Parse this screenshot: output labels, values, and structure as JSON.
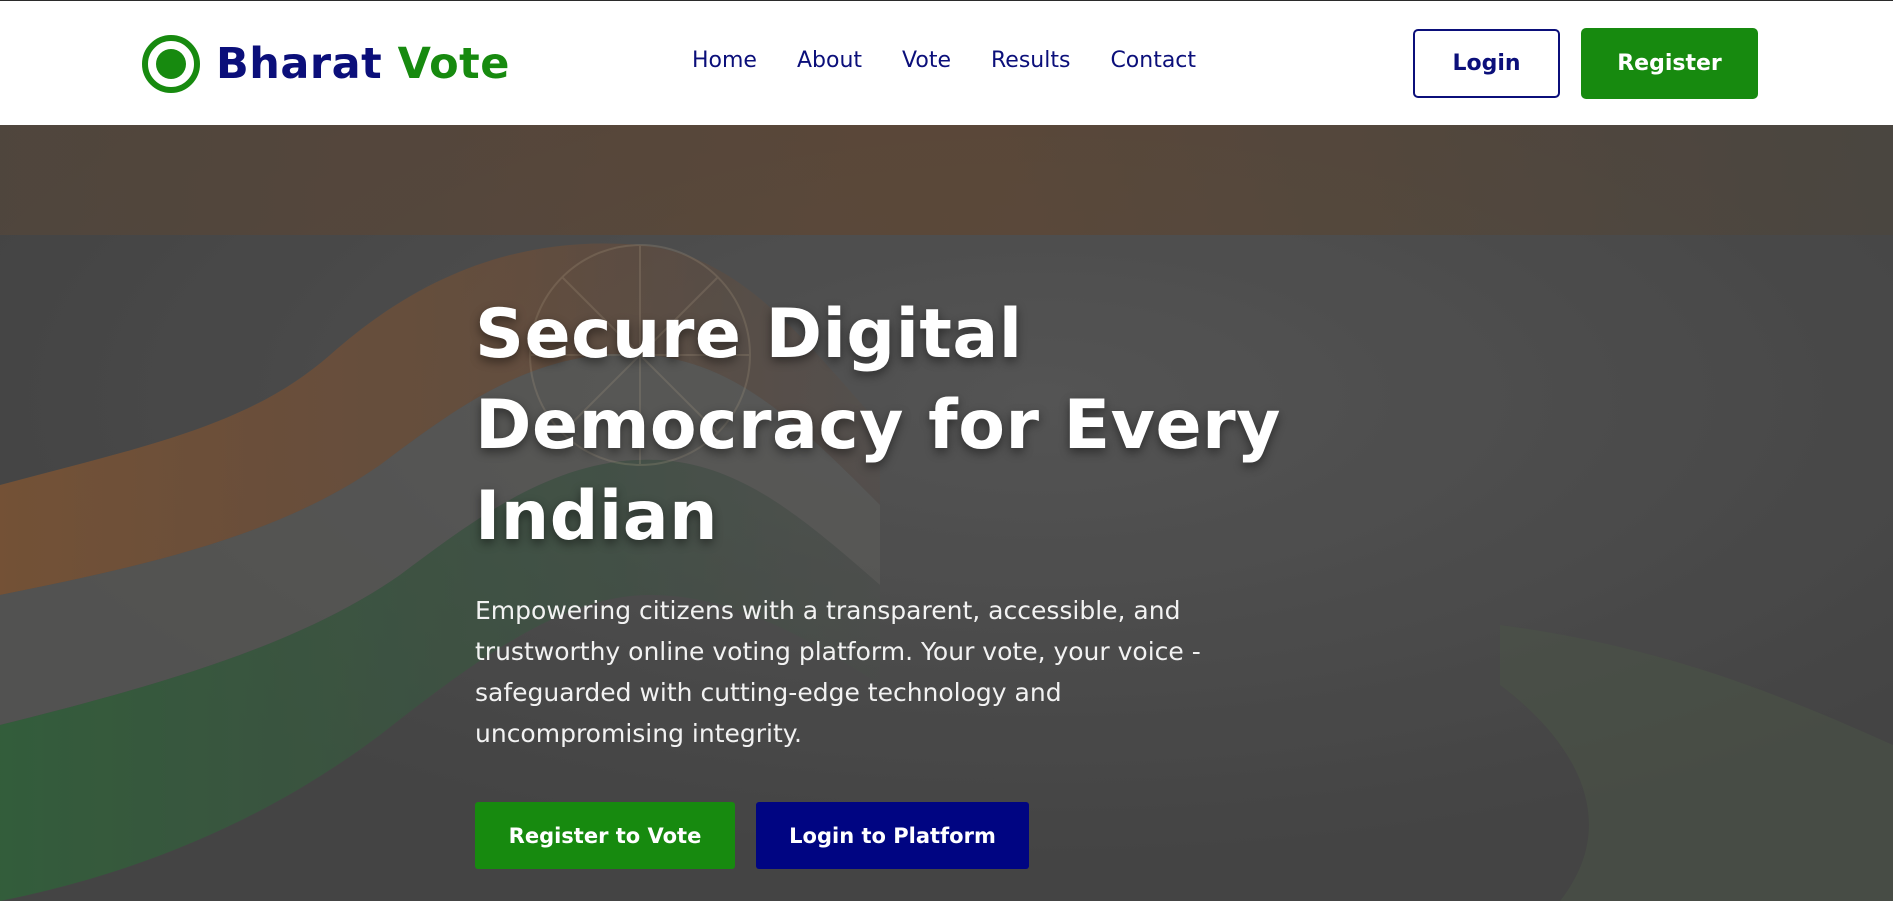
{
  "brand": {
    "name": "Bharat",
    "accent": "Vote",
    "logo_icon": "target-circle-icon",
    "primary_color": "#0b0f7a",
    "accent_color": "#178a0f"
  },
  "nav": {
    "items": [
      {
        "label": "Home"
      },
      {
        "label": "About"
      },
      {
        "label": "Vote"
      },
      {
        "label": "Results"
      },
      {
        "label": "Contact"
      }
    ]
  },
  "header_actions": {
    "login_label": "Login",
    "register_label": "Register"
  },
  "hero": {
    "title": "Secure Digital Democracy for Every Indian",
    "subtitle": "Empowering citizens with a transparent, accessible, and trustworthy online voting platform. Your vote, your voice - safeguarded with cutting-edge technology and uncompromising integrity.",
    "background_image": "indian-flag-waving-backdrop",
    "cta_primary": "Register to Vote",
    "cta_secondary": "Login to Platform",
    "cta_primary_color": "#178a0f",
    "cta_secondary_color": "#000582"
  }
}
